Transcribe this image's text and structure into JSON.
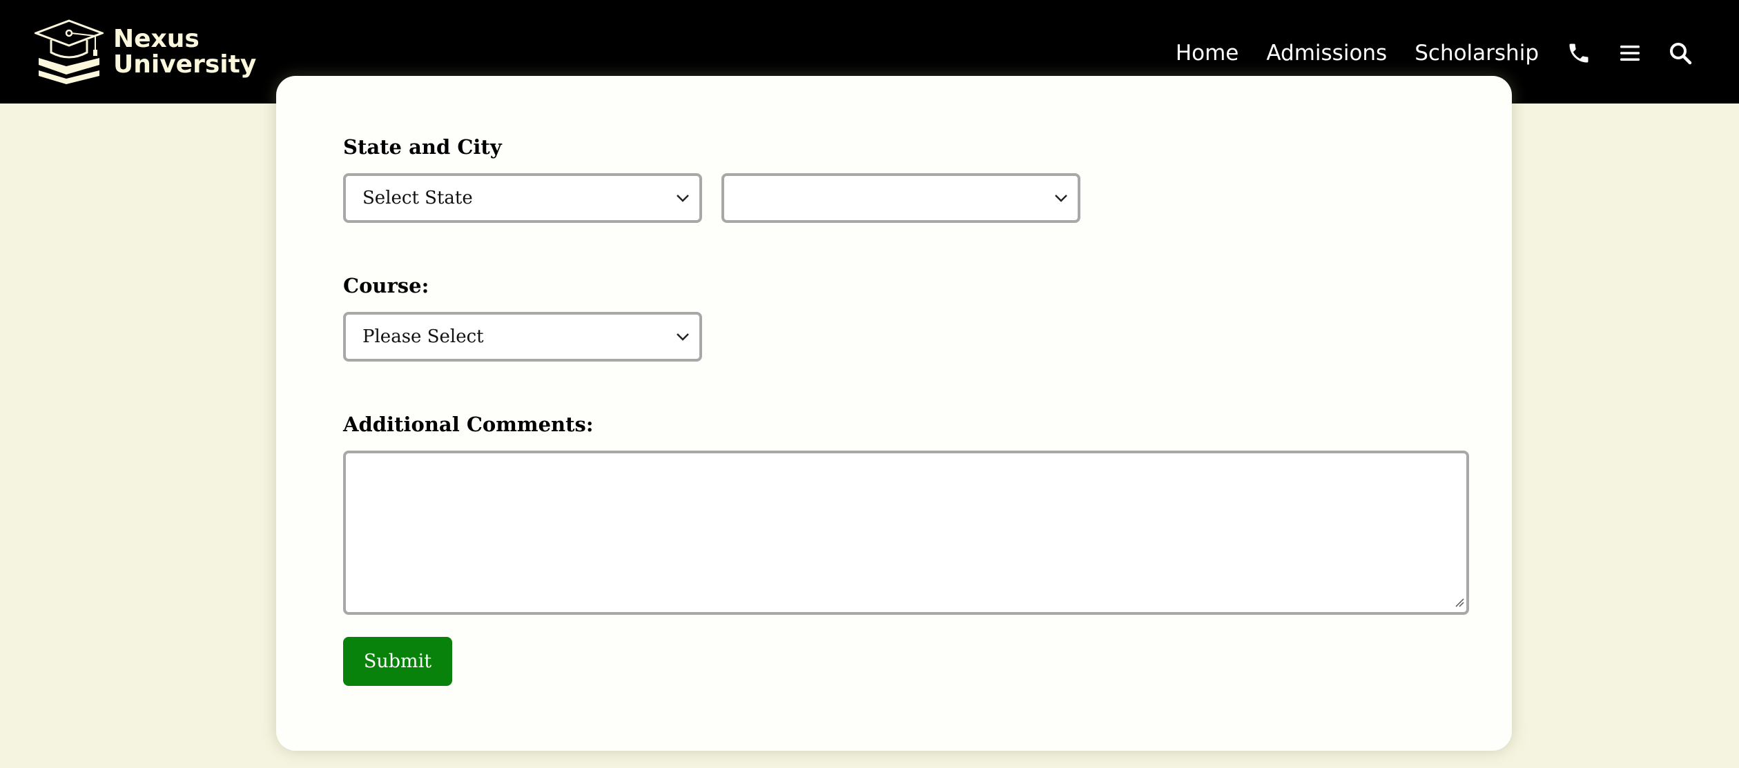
{
  "brand": {
    "name_line1": "Nexus",
    "name_line2": "University",
    "logo_icon": "graduation-cap-books-icon",
    "logo_color": "#fbf7dc"
  },
  "nav": {
    "links": [
      "Home",
      "Admissions",
      "Scholarship"
    ],
    "icons": [
      "phone-icon",
      "menu-icon",
      "search-icon"
    ]
  },
  "form": {
    "state_city_label": "State and City",
    "state_select_value": "Select State",
    "city_select_value": "",
    "course_label": "Course:",
    "course_select_value": "Please Select",
    "comments_label": "Additional Comments:",
    "comments_value": "",
    "submit_label": "Submit"
  },
  "colors": {
    "header_bg": "#000000",
    "page_bg": "#f4f4e0",
    "card_bg": "#fefefa",
    "submit_bg": "#08820a",
    "input_border": "#a8a8a8"
  }
}
